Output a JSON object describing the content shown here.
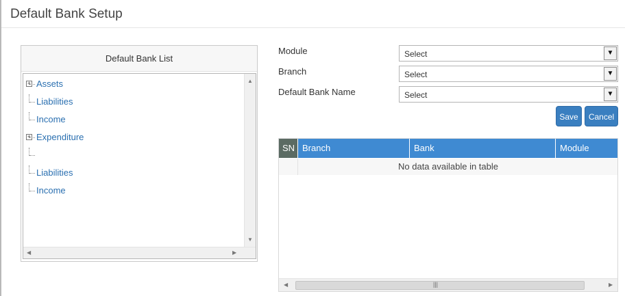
{
  "page": {
    "title": "Default Bank Setup"
  },
  "tree": {
    "header": "Default Bank List",
    "items": [
      {
        "label": "Assets",
        "expandable": true
      },
      {
        "label": "Liabilities",
        "expandable": false
      },
      {
        "label": "Income",
        "expandable": false
      },
      {
        "label": "Expenditure",
        "expandable": true
      },
      {
        "label": "",
        "expandable": false
      },
      {
        "label": "Liabilities",
        "expandable": false
      },
      {
        "label": "Income",
        "expandable": false
      }
    ]
  },
  "form": {
    "module_label": "Module",
    "module_value": "Select",
    "branch_label": "Branch",
    "branch_value": "Select",
    "bank_label": "Default Bank Name",
    "bank_value": "Select",
    "save_label": "Save",
    "cancel_label": "Cancel"
  },
  "table": {
    "columns": [
      "SN",
      "Branch",
      "Bank",
      "Module"
    ],
    "empty_text": "No data available in table"
  },
  "colors": {
    "accent": "#3f8ad2",
    "button": "#3a7fc0",
    "sn_header": "#5b6b63",
    "tree_link": "#2a6fb0"
  }
}
